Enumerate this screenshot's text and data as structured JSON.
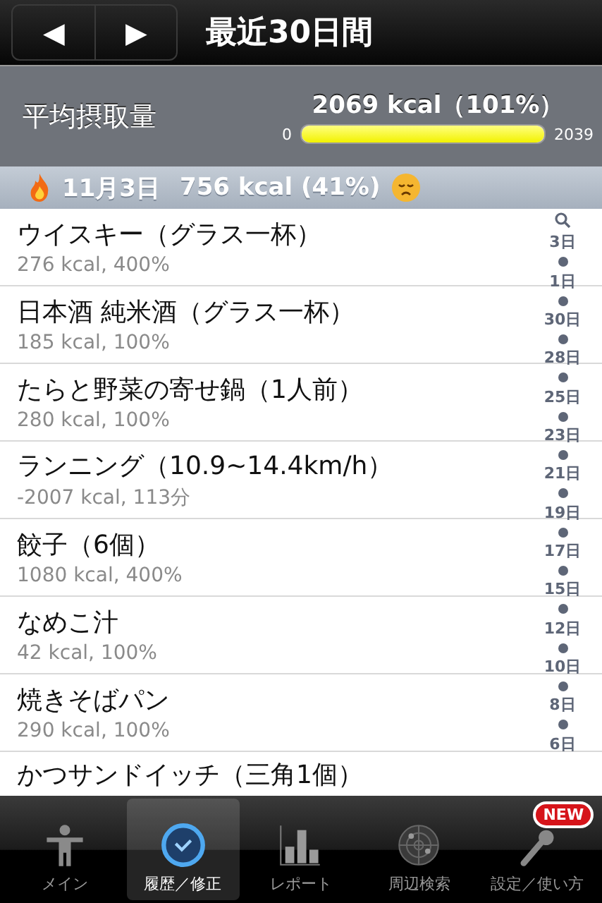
{
  "nav": {
    "prev": "◀",
    "next": "▶",
    "title": "最近30日間"
  },
  "summary": {
    "label": "平均摂取量",
    "value": "2069 kcal（101%）",
    "min": "0",
    "max": "2039",
    "level": 1
  },
  "day": {
    "date": "11月3日",
    "total": "756 kcal (41%)"
  },
  "entries": [
    {
      "name": "ウイスキー（グラス一杯）",
      "detail": "276 kcal, 400%"
    },
    {
      "name": "日本酒 純米酒（グラス一杯）",
      "detail": "185 kcal, 100%"
    },
    {
      "name": "たらと野菜の寄せ鍋（1人前）",
      "detail": "280 kcal, 100%"
    },
    {
      "name": "ランニング（10.9~14.4km/h）",
      "detail": "-2007 kcal, 113分"
    },
    {
      "name": "餃子（6個）",
      "detail": "1080 kcal, 400%"
    },
    {
      "name": "なめこ汁",
      "detail": "42 kcal, 100%"
    },
    {
      "name": "焼きそばパン",
      "detail": "290 kcal, 100%"
    },
    {
      "name": "かつサンドイッチ（三角1個）"
    }
  ],
  "index": [
    "3日",
    "1日",
    "30日",
    "28日",
    "25日",
    "23日",
    "21日",
    "19日",
    "17日",
    "15日",
    "12日",
    "10日",
    "8日",
    "6日"
  ],
  "tabs": [
    {
      "label": "メイン",
      "selected": false
    },
    {
      "label": "履歴／修正",
      "selected": true
    },
    {
      "label": "レポート",
      "selected": false
    },
    {
      "label": "周辺検索",
      "selected": false
    },
    {
      "label": "設定／使い方",
      "selected": false,
      "badge": "NEW"
    }
  ]
}
